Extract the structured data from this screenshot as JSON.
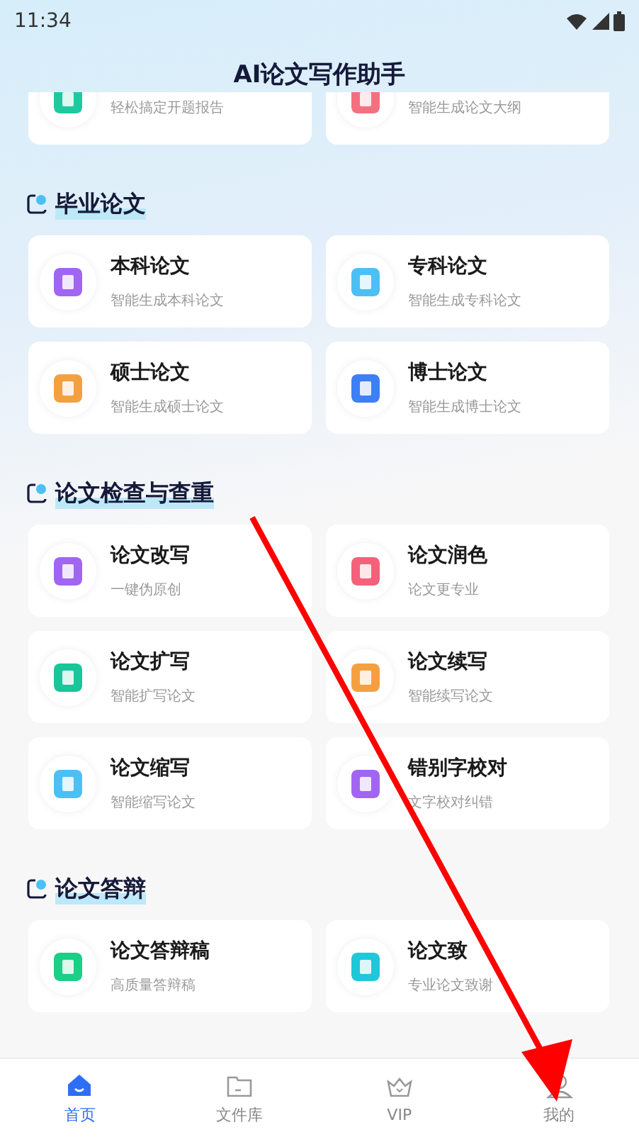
{
  "status_bar": {
    "time": "11:34"
  },
  "title": "AI论文写作助手",
  "cut_row": [
    {
      "subtitle": "轻松搞定开题报告",
      "color": "#1ec9a0"
    },
    {
      "subtitle": "智能生成论文大纲",
      "color": "#f5707f"
    }
  ],
  "sections": [
    {
      "title": "毕业论文",
      "cards": [
        {
          "title": "本科论文",
          "subtitle": "智能生成本科论文",
          "color": "#a066f2"
        },
        {
          "title": "专科论文",
          "subtitle": "智能生成专科论文",
          "color": "#4cc0f5"
        },
        {
          "title": "硕士论文",
          "subtitle": "智能生成硕士论文",
          "color": "#f5a040"
        },
        {
          "title": "博士论文",
          "subtitle": "智能生成博士论文",
          "color": "#3d7ff5"
        }
      ]
    },
    {
      "title": "论文检查与查重",
      "cards": [
        {
          "title": "论文改写",
          "subtitle": "一键伪原创",
          "color": "#a066f2"
        },
        {
          "title": "论文润色",
          "subtitle": "论文更专业",
          "color": "#f5607a"
        },
        {
          "title": "论文扩写",
          "subtitle": "智能扩写论文",
          "color": "#18c69a"
        },
        {
          "title": "论文续写",
          "subtitle": "智能续写论文",
          "color": "#f5a040"
        },
        {
          "title": "论文缩写",
          "subtitle": "智能缩写论文",
          "color": "#4cc0f5"
        },
        {
          "title": "错别字校对",
          "subtitle": "文字校对纠错",
          "color": "#a066f2"
        }
      ]
    },
    {
      "title": "论文答辩",
      "cards": [
        {
          "title": "论文答辩稿",
          "subtitle": "高质量答辩稿",
          "color": "#1ccf86"
        },
        {
          "title": "论文致",
          "subtitle": "专业论文致谢",
          "color": "#1ec8d8"
        }
      ]
    }
  ],
  "nav": [
    {
      "label": "首页",
      "kind": "home",
      "selected": true
    },
    {
      "label": "文件库",
      "kind": "folder",
      "selected": false
    },
    {
      "label": "VIP",
      "kind": "crown",
      "selected": false
    },
    {
      "label": "我的",
      "kind": "person",
      "selected": false
    }
  ]
}
